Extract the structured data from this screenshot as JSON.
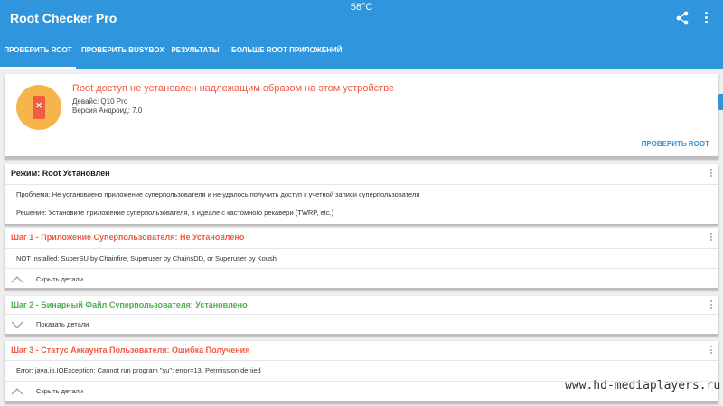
{
  "status": {
    "temperature": "58°C"
  },
  "app": {
    "title": "Root Checker Pro",
    "accent_color": "#2f96dd",
    "share_icon": "share-icon",
    "menu_icon": "more-vert-icon"
  },
  "tabs": [
    {
      "label": "ПРОВЕРИТЬ ROOT",
      "active": true
    },
    {
      "label": "ПРОВЕРИТЬ BUSYBOX",
      "active": false
    },
    {
      "label": "РЕЗУЛЬТАТЫ",
      "active": false
    },
    {
      "label": "БОЛЬШЕ ROOT ПРИЛОЖЕНИЙ",
      "active": false
    }
  ],
  "main_card": {
    "icon": "phone-error-icon",
    "title": "Root доступ не установлен надлежащим образом на этом устройстве",
    "device": "Девайс: Q10 Pro",
    "android_version": "Версия Андроид: 7.0",
    "action_label": "ПРОВЕРИТЬ ROOT",
    "title_color": "#ef5b45"
  },
  "mode_card": {
    "title": "Режим: Root Установлен",
    "problem": "Проблема: Не установлено приложение суперпользователя и не удалось получить доступ к учетной записи суперпользователя",
    "solution": "Решение: Установите приложение суперпользователя, в идеале с кастомного рекавери (TWRP, etc.)"
  },
  "steps": [
    {
      "title": "Шаг 1 - Приложение Суперпользователя: Не Установлено",
      "color": "#ef5b45",
      "detail": "NOT installed: SuperSU by Chainfire, Superuser by ChainsDD, or Superuser by Koush",
      "toggle_label": "Скрыть детали",
      "expanded": true
    },
    {
      "title": "Шаг 2 - Бинарный Файл Суперпользователя: Установлено",
      "color": "#4caf50",
      "detail": "",
      "toggle_label": "Показать детали",
      "expanded": false
    },
    {
      "title": "Шаг 3 - Статус Аккаунта Пользователя: Ошибка Получения",
      "color": "#ef5b45",
      "detail": "Error: java.io.IOException: Cannot run program \"su\": error=13, Permission denied",
      "toggle_label": "Скрыть детали",
      "expanded": true
    }
  ],
  "watermark": "www.hd-mediaplayers.ru"
}
